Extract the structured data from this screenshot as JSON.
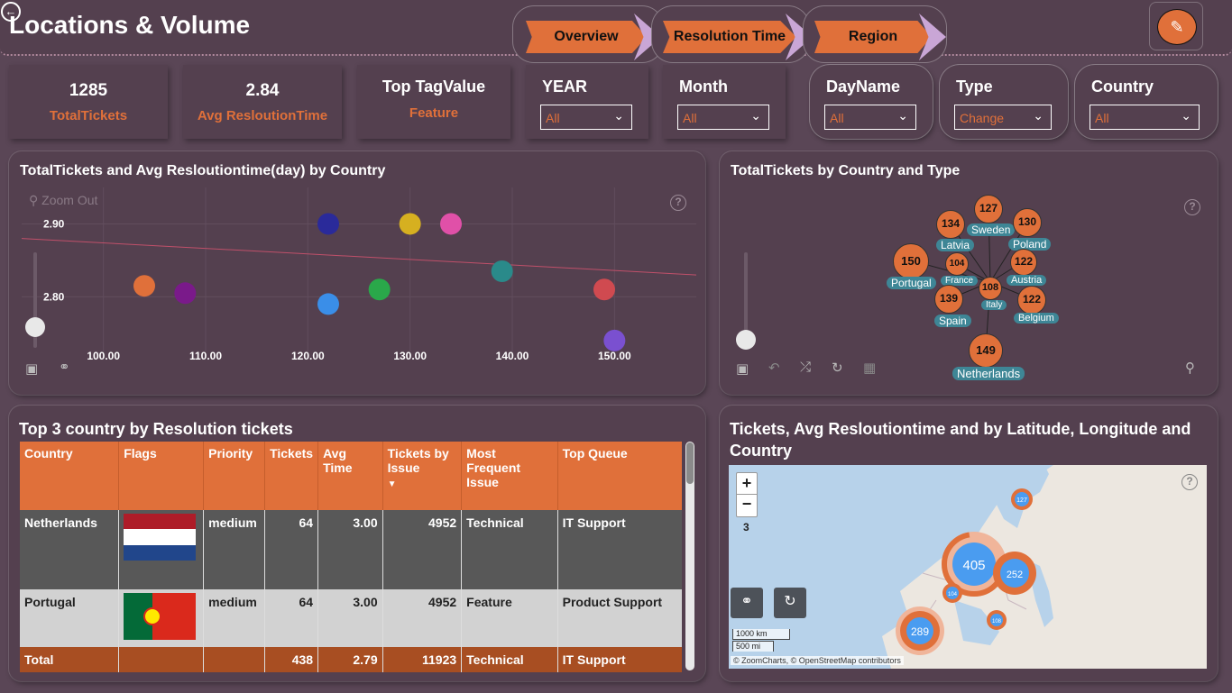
{
  "header": {
    "title": "Locations & Volume",
    "nav": [
      "Overview",
      "Resolution Time",
      "Region"
    ]
  },
  "kpis": [
    {
      "value": "1285",
      "label": "TotalTickets"
    },
    {
      "value": "2.84",
      "label": "Avg ResloutionTime"
    },
    {
      "value": "Top TagValue",
      "label": "Feature"
    }
  ],
  "slicers": [
    {
      "label": "YEAR",
      "value": "All"
    },
    {
      "label": "Month",
      "value": "All"
    },
    {
      "label": "DayName",
      "value": "All"
    },
    {
      "label": "Type",
      "value": "Change"
    },
    {
      "label": "Country",
      "value": "All"
    }
  ],
  "scatter": {
    "title": "TotalTickets and Avg Resloutiontime(day) by Country",
    "zoom_out": "Zoom Out",
    "chart_data": {
      "type": "scatter",
      "x_ticks": [
        "100.00",
        "110.00",
        "120.00",
        "130.00",
        "140.00",
        "150.00"
      ],
      "y_ticks": [
        "2.90",
        "2.80"
      ],
      "xlim": [
        92,
        158
      ],
      "ylim": [
        2.725,
        2.95
      ],
      "points": [
        {
          "x": 104,
          "y": 2.815,
          "color": "#e0703a"
        },
        {
          "x": 108,
          "y": 2.805,
          "color": "#7a1a8a"
        },
        {
          "x": 122,
          "y": 2.9,
          "color": "#2a2a9a"
        },
        {
          "x": 122,
          "y": 2.79,
          "color": "#3a8ee8"
        },
        {
          "x": 127,
          "y": 2.81,
          "color": "#2aa84a"
        },
        {
          "x": 130,
          "y": 2.9,
          "color": "#d6b020"
        },
        {
          "x": 134,
          "y": 2.9,
          "color": "#e050a8"
        },
        {
          "x": 139,
          "y": 2.835,
          "color": "#2a8a8a"
        },
        {
          "x": 149,
          "y": 2.81,
          "color": "#d04a50"
        },
        {
          "x": 150,
          "y": 2.74,
          "color": "#7a50d0"
        }
      ],
      "trend": [
        [
          92,
          2.88
        ],
        [
          158,
          2.83
        ]
      ]
    }
  },
  "network": {
    "title": "TotalTickets by Country and Type",
    "nodes": [
      {
        "value": "150",
        "label": "Portugal"
      },
      {
        "value": "134",
        "label": "Latvia"
      },
      {
        "value": "127",
        "label": "Sweden"
      },
      {
        "value": "130",
        "label": "Poland"
      },
      {
        "value": "104",
        "label": "France"
      },
      {
        "value": "122",
        "label": "Austria"
      },
      {
        "value": "108",
        "label": "Italy"
      },
      {
        "value": "139",
        "label": "Spain"
      },
      {
        "value": "122",
        "label": "Belgium"
      },
      {
        "value": "149",
        "label": "Netherlands"
      }
    ]
  },
  "table": {
    "title": "Top 3 country by Resolution tickets",
    "columns": [
      "Country",
      "Flags",
      "Priority",
      "Tickets",
      "Avg Time",
      "Tickets by Issue",
      "Most Frequent Issue",
      "Top Queue"
    ],
    "rows": [
      {
        "country": "Netherlands",
        "priority": "medium",
        "tickets": "64",
        "avg": "3.00",
        "issue_tickets": "4952",
        "issue": "Technical",
        "queue": "IT Support"
      },
      {
        "country": "Portugal",
        "priority": "medium",
        "tickets": "64",
        "avg": "3.00",
        "issue_tickets": "4952",
        "issue": "Feature",
        "queue": "Product Support"
      }
    ],
    "total": {
      "label": "Total",
      "tickets": "438",
      "avg": "2.79",
      "issue_tickets": "11923",
      "issue": "Technical",
      "queue": "IT Support"
    }
  },
  "map": {
    "title": "Tickets, Avg Resloutiontime and by Latitude, Longitude and Country",
    "zoom_level": "3",
    "clusters": [
      "127",
      "405",
      "252",
      "104",
      "108",
      "289"
    ],
    "scale_km": "1000 km",
    "scale_mi": "500 mi",
    "attribution": "© ZoomCharts, © OpenStreetMap contributors"
  }
}
